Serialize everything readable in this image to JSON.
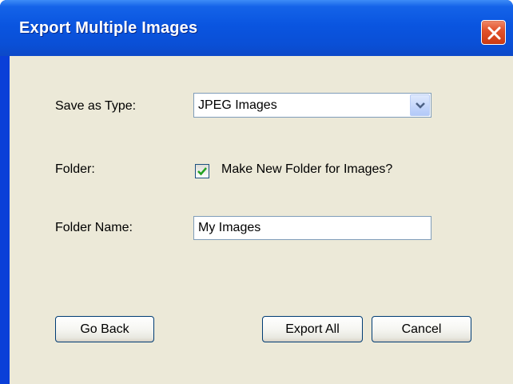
{
  "window": {
    "title": "Export Multiple Images"
  },
  "form": {
    "save_as_type_label": "Save as Type:",
    "save_as_type_value": "JPEG Images",
    "folder_label": "Folder:",
    "make_new_folder_label": "Make New Folder for Images?",
    "make_new_folder_checked": true,
    "folder_name_label": "Folder Name:",
    "folder_name_value": "My Images"
  },
  "buttons": {
    "go_back": "Go Back",
    "export_all": "Export All",
    "cancel": "Cancel"
  },
  "icons": {
    "close": "close-icon",
    "dropdown": "chevron-down-icon",
    "check": "checkmark-icon"
  },
  "colors": {
    "title_bar": "#0a55e0",
    "dialog_background": "#ece9d8",
    "close_button": "#e2532c",
    "checkmark": "#21a121"
  }
}
